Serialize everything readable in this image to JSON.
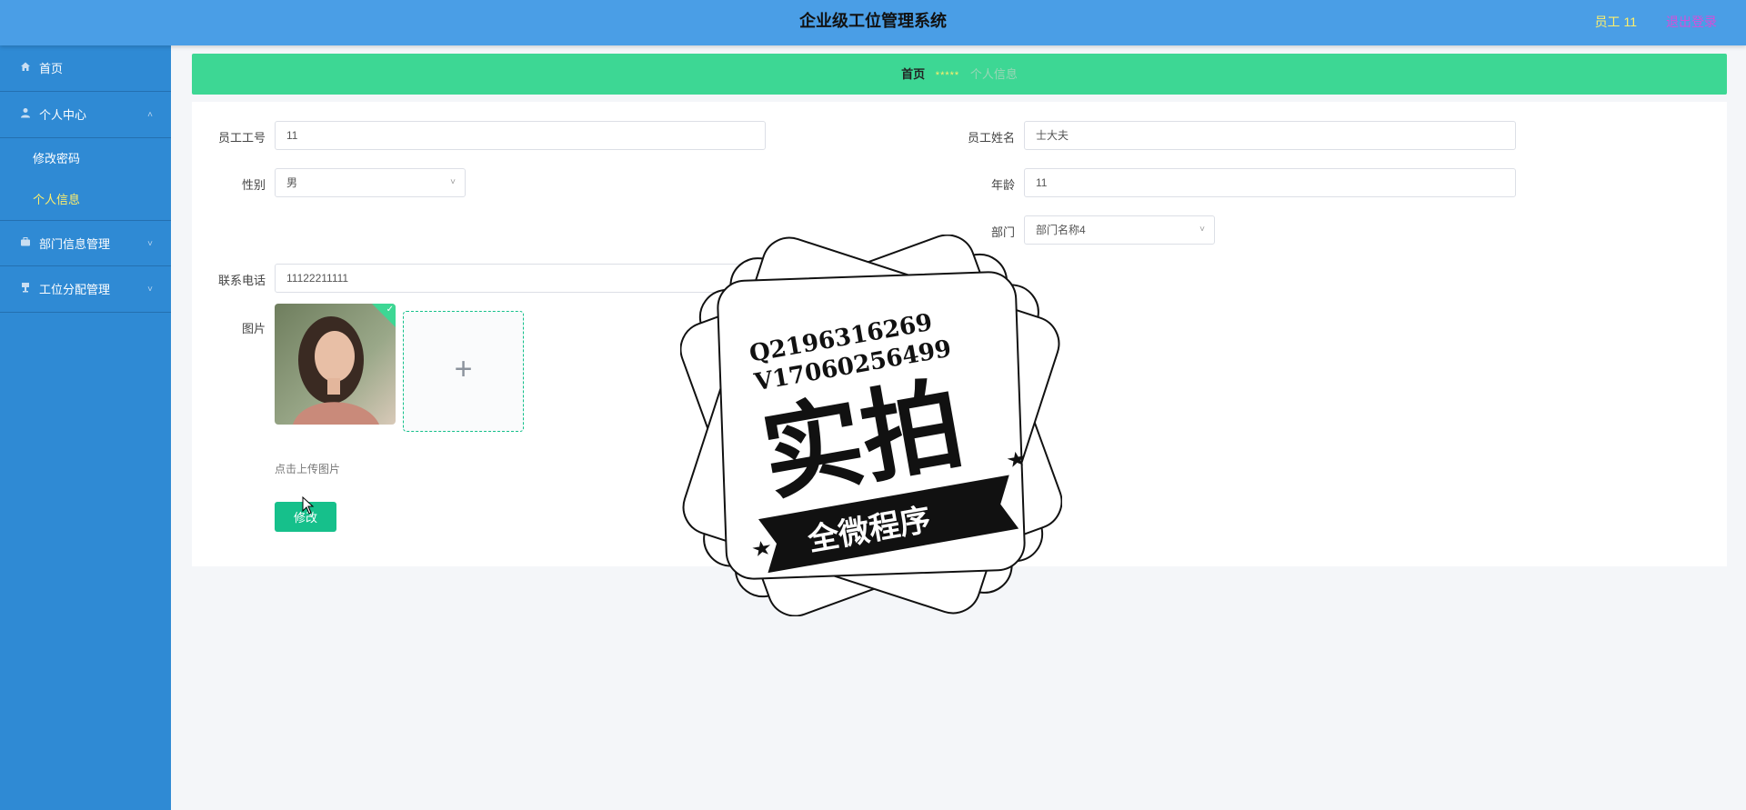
{
  "app": {
    "title": "企业级工位管理系统"
  },
  "header": {
    "user_label": "员工 11",
    "logout_label": "退出登录"
  },
  "sidebar": {
    "items": [
      {
        "label": "首页",
        "icon": "home-icon"
      },
      {
        "label": "个人中心",
        "icon": "user-icon",
        "expanded": true,
        "children": [
          {
            "label": "修改密码"
          },
          {
            "label": "个人信息",
            "active": true
          }
        ]
      },
      {
        "label": "部门信息管理",
        "icon": "briefcase-icon",
        "expanded": false
      },
      {
        "label": "工位分配管理",
        "icon": "desk-icon",
        "expanded": false
      }
    ]
  },
  "breadcrumb": {
    "home": "首页",
    "separator": "*****",
    "current": "个人信息"
  },
  "form": {
    "employee_no": {
      "label": "员工工号",
      "value": "11"
    },
    "employee_name": {
      "label": "员工姓名",
      "value": "士大夫"
    },
    "gender": {
      "label": "性别",
      "value": "男"
    },
    "age": {
      "label": "年龄",
      "value": "11"
    },
    "department": {
      "label": "部门",
      "value": "部门名称4"
    },
    "phone": {
      "label": "联系电话",
      "value": "11122211111"
    },
    "photo": {
      "label": "图片",
      "upload_hint": "点击上传图片"
    },
    "submit_label": "修改"
  },
  "watermark": {
    "line1": "Q2196316269",
    "line2": "V17060256499",
    "main": "实拍",
    "banner": "全微程序"
  },
  "colors": {
    "header": "#4a9ee6",
    "sidebar": "#2f8ad4",
    "breadcrumb": "#3dd794",
    "primary_button": "#16c08b",
    "active_menu": "#ffef6b",
    "logout": "#d44fd9"
  }
}
